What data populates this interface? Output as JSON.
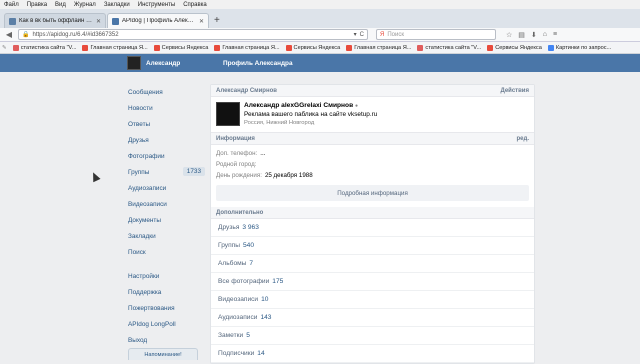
{
  "menu": [
    "Файл",
    "Правка",
    "Вид",
    "Журнал",
    "Закладки",
    "Инструменты",
    "Справка"
  ],
  "tabs": [
    {
      "title": "Как в вк быть оффлайн с к...",
      "color": "#5b7fa6",
      "active": false
    },
    {
      "title": "APIdog | Профиль Александр...",
      "color": "#4a76a8",
      "active": true
    }
  ],
  "newtab": "+",
  "nav": {
    "url": "https://apidog.ru/6.4/#id3667352",
    "search_placeholder": "Поиск",
    "back": "◀",
    "forward": "▶",
    "reload": "C"
  },
  "bookmarks": [
    {
      "label": "статистика сайта \"V...",
      "color": "#e05d5d"
    },
    {
      "label": "Главная страница Я...",
      "color": "#e84b3c"
    },
    {
      "label": "Сервисы Яндекса",
      "color": "#e84b3c"
    },
    {
      "label": "Главная страница Я...",
      "color": "#e84b3c"
    },
    {
      "label": "Сервисы Яндекса",
      "color": "#e84b3c"
    },
    {
      "label": "Главная страница Я...",
      "color": "#e84b3c"
    },
    {
      "label": "статистика сайта \"V...",
      "color": "#e05d5d"
    },
    {
      "label": "Сервисы Яндекса",
      "color": "#e84b3c"
    },
    {
      "label": "Картинки по запрос...",
      "color": "#4285f4"
    }
  ],
  "header": {
    "user_name": "Александр",
    "page_title": "Профиль Александра"
  },
  "sidebar": {
    "items": [
      {
        "label": "Сообщения",
        "count": ""
      },
      {
        "label": "Новости",
        "count": ""
      },
      {
        "label": "Ответы",
        "count": ""
      },
      {
        "label": "Друзья",
        "count": ""
      },
      {
        "label": "Фотографии",
        "count": ""
      },
      {
        "label": "Группы",
        "count": "1733"
      },
      {
        "label": "Аудиозаписи",
        "count": ""
      },
      {
        "label": "Видеозаписи",
        "count": ""
      },
      {
        "label": "Документы",
        "count": ""
      },
      {
        "label": "Закладки",
        "count": ""
      },
      {
        "label": "Поиск",
        "count": ""
      }
    ],
    "items2": [
      {
        "label": "Настройки"
      },
      {
        "label": "Поддержка"
      },
      {
        "label": "Пожертвования"
      },
      {
        "label": "APIdog LongPoll"
      },
      {
        "label": "Выход"
      }
    ],
    "bottom_button": "Напоминание!"
  },
  "profile": {
    "header_name": "Александр Смирнов",
    "header_action": "Действия",
    "name": "Александр alexGGrelaxi Смирнов",
    "verified_mark": "●",
    "status": "Реклама вашего паблика на сайте vksetup.ru",
    "location": "Россия, Нижний Новгород"
  },
  "info": {
    "header": "Информация",
    "edit": "ред.",
    "rows": [
      {
        "label": "Доп. телефон:",
        "value": "..."
      },
      {
        "label": "Родной город:",
        "value": ""
      },
      {
        "label": "День рождения:",
        "value": "25 декабря 1988"
      }
    ],
    "detail_button": "Подробная информация"
  },
  "more": {
    "header": "Дополнительно",
    "rows": [
      {
        "label": "Друзья",
        "value": "3 963"
      },
      {
        "label": "Группы",
        "value": "540"
      },
      {
        "label": "Альбомы",
        "value": "7"
      },
      {
        "label": "Все фотографии",
        "value": "175"
      },
      {
        "label": "Видеозаписи",
        "value": "10"
      },
      {
        "label": "Аудиозаписи",
        "value": "143"
      },
      {
        "label": "Заметки",
        "value": "5"
      },
      {
        "label": "Подписчики",
        "value": "14"
      }
    ]
  }
}
